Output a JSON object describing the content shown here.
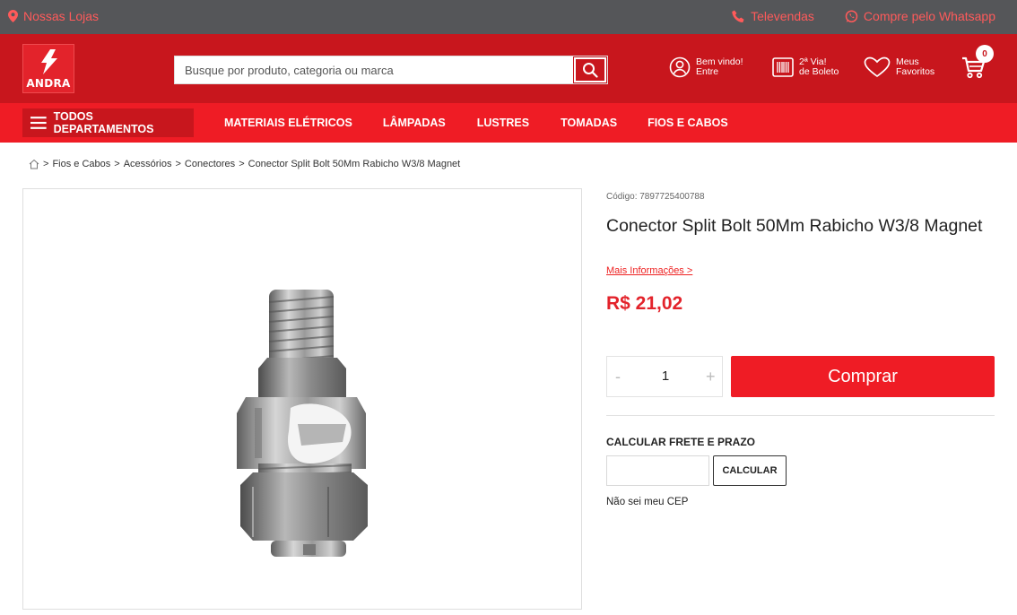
{
  "topbar": {
    "stores": "Nossas Lojas",
    "telesales": "Televendas",
    "whatsapp": "Compre pelo Whatsapp"
  },
  "header": {
    "logo_text": "ANDRA",
    "search_placeholder": "Busque por produto, categoria ou marca",
    "login_line1": "Bem vindo!",
    "login_line2": "Entre",
    "boleto_line1": "2ª Via!",
    "boleto_line2": "de Boleto",
    "fav_line1": "Meus",
    "fav_line2": "Favoritos",
    "cart_count": "0"
  },
  "nav": {
    "departments": "TODOS DEPARTAMENTOS",
    "items": [
      "MATERIAIS ELÉTRICOS",
      "LÂMPADAS",
      "LUSTRES",
      "TOMADAS",
      "FIOS E CABOS"
    ]
  },
  "breadcrumb": [
    "Fios e Cabos",
    "Acessórios",
    "Conectores",
    "Conector Split Bolt 50Mm Rabicho W3/8 Magnet"
  ],
  "product": {
    "code": "Código: 7897725400788",
    "title": "Conector Split Bolt 50Mm Rabicho W3/8 Magnet",
    "more_info": "Mais Informações >",
    "price": "R$ 21,02",
    "qty_minus": "-",
    "qty": "1",
    "qty_plus": "+",
    "buy": "Comprar",
    "freight_title": "CALCULAR FRETE E PRAZO",
    "cep_value": "",
    "calc": "CALCULAR",
    "no_cep": "Não sei meu CEP"
  },
  "colors": {
    "brand_red": "#c8161d",
    "nav_red": "#ef1c25",
    "topbar_gray": "#555659",
    "price_red": "#e3232b"
  },
  "icons": [
    "location-pin-icon",
    "phone-icon",
    "whatsapp-icon",
    "search-icon",
    "user-icon",
    "barcode-icon",
    "heart-icon",
    "cart-icon",
    "hamburger-icon",
    "home-icon"
  ]
}
